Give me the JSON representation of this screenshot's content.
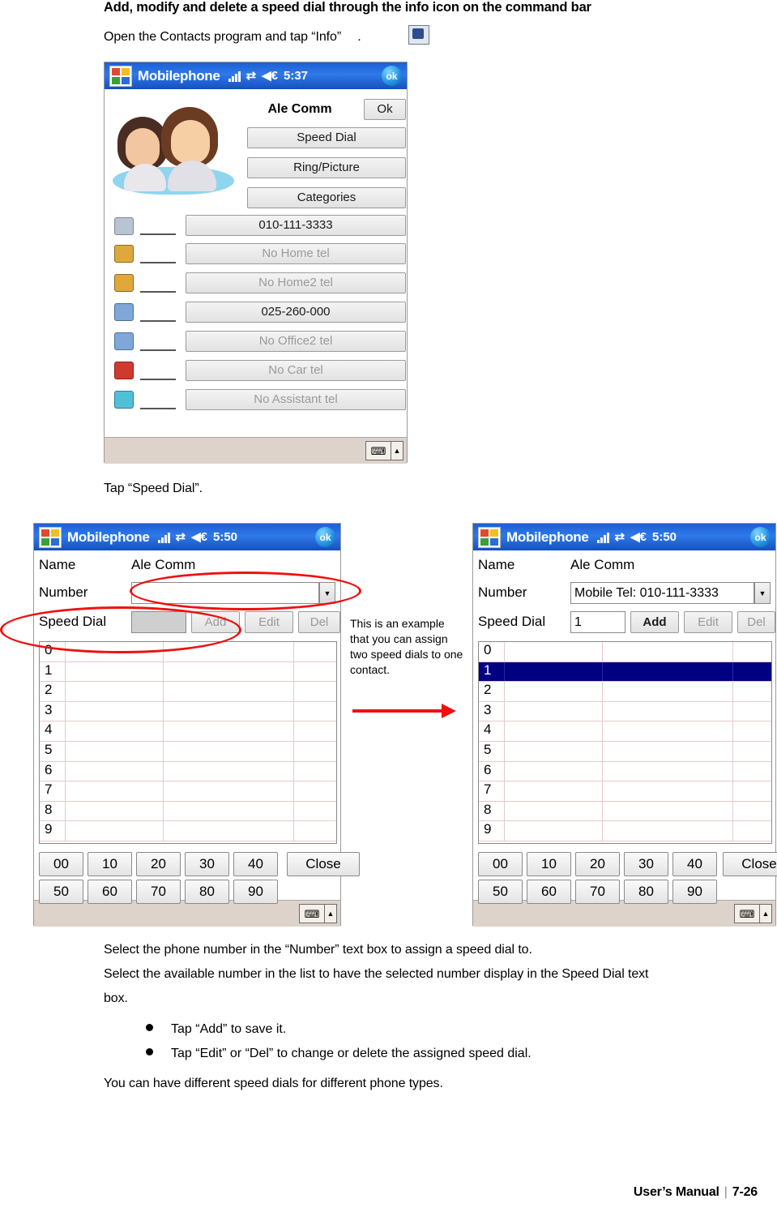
{
  "document": {
    "heading": "Add, modify and delete a speed dial through the info icon on the command bar",
    "intro": "Open the Contacts program and tap “Info”　  .",
    "tap_speed_dial": "Tap “Speed Dial”.",
    "para1": "Select the phone number in the “Number”  text box to assign a speed dial to.",
    "para2": "Select the available number in the list to have the selected number display in the Speed Dial text",
    "para2b": "box.",
    "bullets": [
      "Tap “Add”  to save it.",
      "Tap “Edit” or “Del”  to change or delete the assigned speed dial."
    ],
    "para3": "You can have different speed dials for different phone types.",
    "footer": {
      "manual": "User’s Manual",
      "separator": "|",
      "page": "7-26"
    }
  },
  "callout": {
    "text": "This is an example that you can assign two speed dials to one contact."
  },
  "shot1": {
    "titlebar": {
      "app": "Mobilephone",
      "time": "5:37",
      "ok": "ok",
      "signal_icon": "signal-bars-icon",
      "connect_icon": "connectivity-icon",
      "volume_icon": "volume-icon",
      "start_icon": "windows-start-icon"
    },
    "contact_name": "Ale Comm",
    "ok_button": "Ok",
    "buttons": [
      "Speed Dial",
      "Ring/Picture",
      "Categories"
    ],
    "fields": [
      {
        "icon": "mobile-phone-icon",
        "value": "010-111-3333",
        "enabled": true
      },
      {
        "icon": "home-icon",
        "value": "No Home tel",
        "enabled": false
      },
      {
        "icon": "home2-icon",
        "value": "No Home2 tel",
        "enabled": false
      },
      {
        "icon": "office-icon",
        "value": "025-260-000",
        "enabled": true
      },
      {
        "icon": "office2-icon",
        "value": "No Office2 tel",
        "enabled": false
      },
      {
        "icon": "car-icon",
        "value": "No Car tel",
        "enabled": false
      },
      {
        "icon": "assistant-icon",
        "value": "No Assistant tel",
        "enabled": false
      }
    ],
    "softbar": {
      "keyboard_icon": "keyboard-icon",
      "chevron_icon": "chevron-up-icon"
    }
  },
  "shot2": {
    "titlebar": {
      "app": "Mobilephone",
      "time": "5:50",
      "ok": "ok"
    },
    "labels": {
      "name": "Name",
      "number": "Number",
      "speed_dial": "Speed Dial"
    },
    "name_value": "Ale Comm",
    "number_value": "",
    "speed_dial_value": "",
    "buttons": {
      "add": "Add",
      "edit": "Edit",
      "del": "Del",
      "close": "Close"
    },
    "buttons_enabled": {
      "add": false,
      "edit": false,
      "del": false
    },
    "list_rows": [
      "0",
      "1",
      "2",
      "3",
      "4",
      "5",
      "6",
      "7",
      "8",
      "9"
    ],
    "selected_row": -1,
    "pager_row1": [
      "00",
      "10",
      "20",
      "30",
      "40"
    ],
    "pager_row2": [
      "50",
      "60",
      "70",
      "80",
      "90"
    ]
  },
  "shot3": {
    "titlebar": {
      "app": "Mobilephone",
      "time": "5:50",
      "ok": "ok"
    },
    "labels": {
      "name": "Name",
      "number": "Number",
      "speed_dial": "Speed Dial"
    },
    "name_value": "Ale Comm",
    "number_value": "Mobile Tel: 010-111-3333",
    "speed_dial_value": "1",
    "buttons": {
      "add": "Add",
      "edit": "Edit",
      "del": "Del",
      "close": "Close"
    },
    "buttons_enabled": {
      "add": true,
      "edit": false,
      "del": false
    },
    "list_rows": [
      "0",
      "1",
      "2",
      "3",
      "4",
      "5",
      "6",
      "7",
      "8",
      "9"
    ],
    "selected_row": 1,
    "pager_row1": [
      "00",
      "10",
      "20",
      "30",
      "40"
    ],
    "pager_row2": [
      "50",
      "60",
      "70",
      "80",
      "90"
    ]
  },
  "colors": {
    "titlebar_blue": "#2f79e8",
    "selection_navy": "#000080",
    "annotation_red": "#ee1111",
    "softbar": "#ded3cb"
  }
}
